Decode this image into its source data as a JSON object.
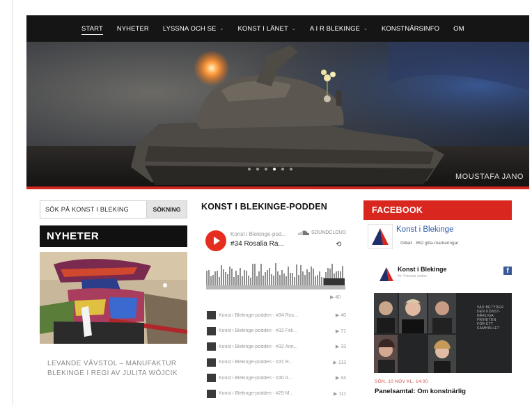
{
  "nav": {
    "items": [
      {
        "label": "START",
        "has_dropdown": false,
        "active": true
      },
      {
        "label": "NYHETER",
        "has_dropdown": false
      },
      {
        "label": "LYSSNA OCH SE",
        "has_dropdown": true
      },
      {
        "label": "KONST I LÄNET",
        "has_dropdown": true
      },
      {
        "label": "A I R BLEKINGE",
        "has_dropdown": true
      },
      {
        "label": "KONSTNÄRSINFO",
        "has_dropdown": false
      },
      {
        "label": "OM",
        "has_dropdown": false
      }
    ],
    "caret": "⌄"
  },
  "hero": {
    "credit": "MOUSTAFA JANO",
    "slide_count": 6,
    "active_slide": 4
  },
  "search": {
    "placeholder": "SÖK PÅ KONST I BLEKING",
    "button_label": "SÖKNING"
  },
  "news": {
    "heading": "NYHETER",
    "caption": "LEVANDE VÄVSTOL – MANUFAKTUR BLEKINGE I REGI AV JULITA WÓJCIK"
  },
  "podcast": {
    "heading": "KONST I BLEKINGE-PODDEN",
    "player": {
      "user": "Konst i Blekinge-pod...",
      "track": "#34 Rosalia Ra...",
      "service": "SOUNDCLOUD",
      "repost_icon": "⟲",
      "play_count": "▶ 40",
      "tracks": [
        {
          "name": "Konst i Blekinge-podden - #34 Ros...",
          "plays": "▶ 40"
        },
        {
          "name": "Konst i Blekinge-podden - #32 Feli...",
          "plays": "▶ 71"
        },
        {
          "name": "Konst i Blekinge-podden - #32 Ann...",
          "plays": "▶ 33"
        },
        {
          "name": "Konst i Blekinge-podden - #31 R...",
          "plays": "▶ 113"
        },
        {
          "name": "Konst i Blekinge-podden - #30 A...",
          "plays": "▶ 44"
        },
        {
          "name": "Konst i Blekinge-podden - #29 M...",
          "plays": "▶ 111"
        }
      ]
    }
  },
  "facebook": {
    "heading": "FACEBOOK",
    "page_name": "Konst i Blekinge",
    "liked_text": "Gillad · 862 gilla-markeringar",
    "post_name": "Konst i Blekinge",
    "post_sub": "för 4 timmar sedan",
    "fb_icon": "f",
    "panel_text": "VAD BETYDER DEN KONST- NÄRLIGA FRIHETEN FÖR ETT SAMHÄLLE?",
    "event_date": "SÖN, 10 NOV KL. 14:00",
    "event_title": "Panelsamtal: Om konstnärlig"
  },
  "colors": {
    "accent_red": "#d9271f",
    "nav_bg": "#151515",
    "soundcloud_red": "#e52e1f",
    "facebook_blue": "#3b5998"
  }
}
